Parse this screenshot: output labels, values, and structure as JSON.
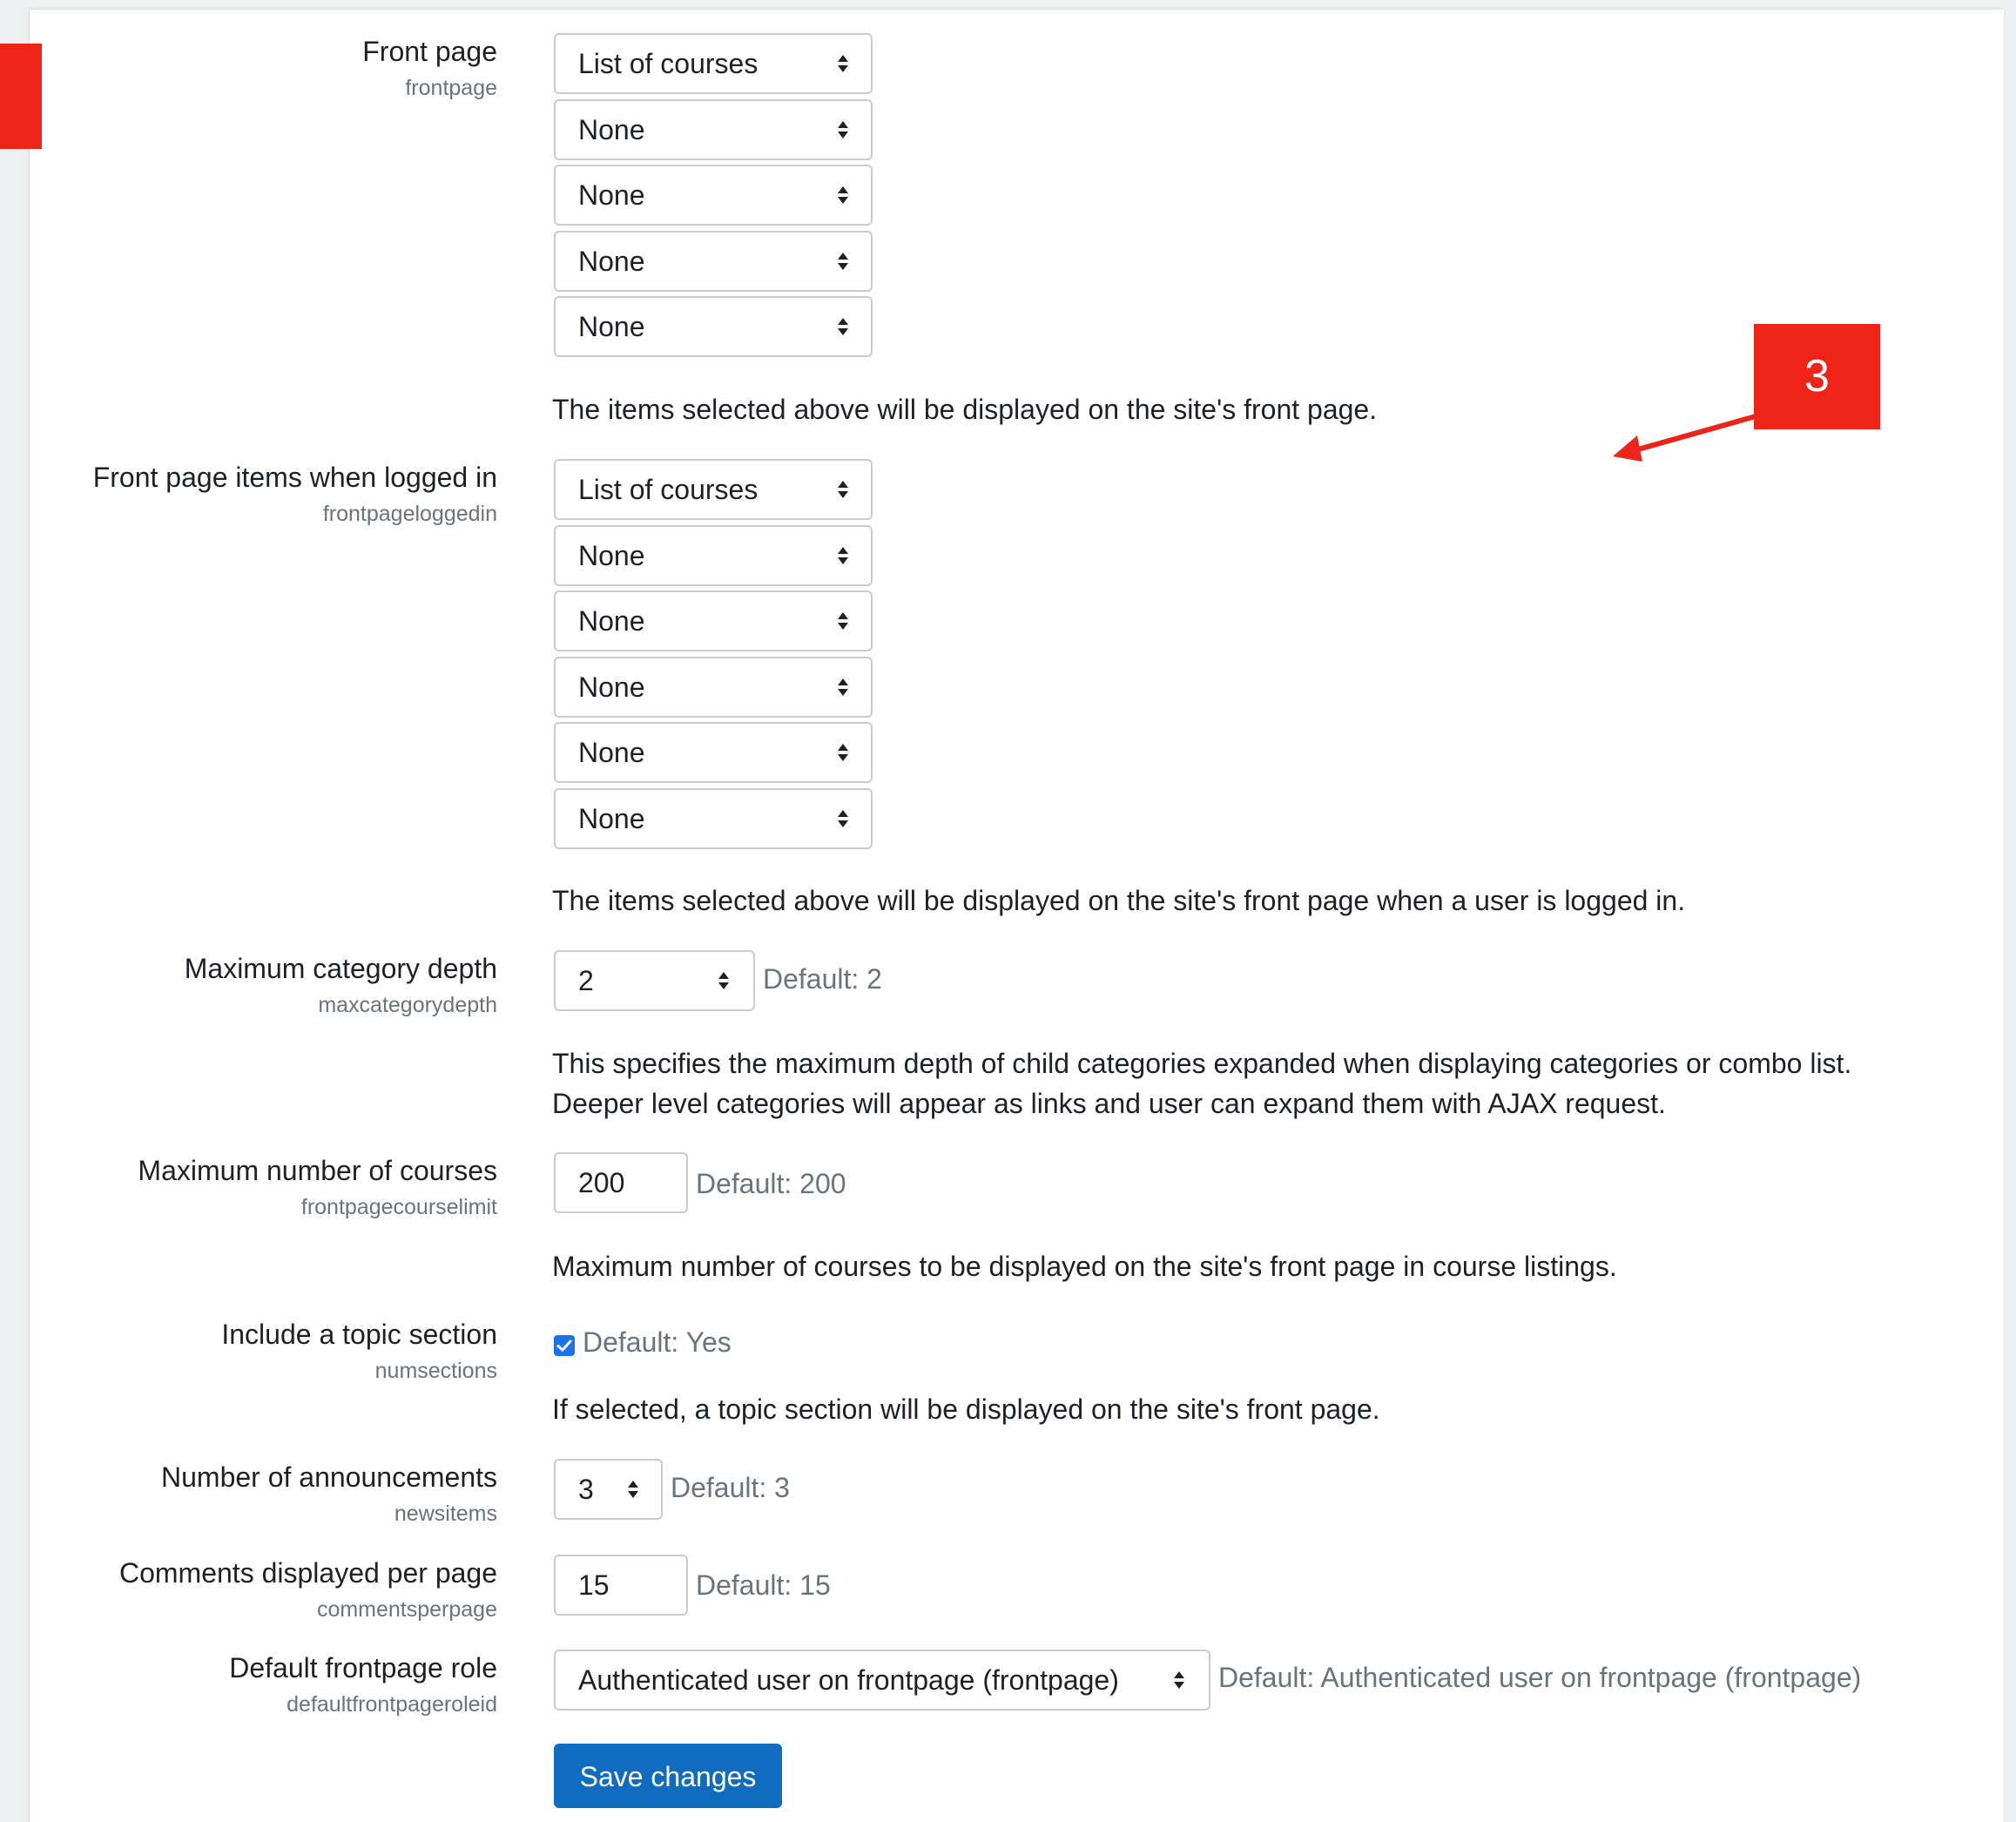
{
  "front_page": {
    "label": "Front page",
    "key": "frontpage",
    "selects": [
      "List of courses",
      "None",
      "None",
      "None",
      "None"
    ],
    "description": "The items selected above will be displayed on the site's front page."
  },
  "front_page_logged_in": {
    "label": "Front page items when logged in",
    "key": "frontpageloggedin",
    "selects": [
      "List of courses",
      "None",
      "None",
      "None",
      "None",
      "None"
    ],
    "description": "The items selected above will be displayed on the site's front page when a user is logged in."
  },
  "max_category_depth": {
    "label": "Maximum category depth",
    "key": "maxcategorydepth",
    "value": "2",
    "default": "Default: 2",
    "description_line1": "This specifies the maximum depth of child categories expanded when displaying categories or combo list.",
    "description_line2": "Deeper level categories will appear as links and user can expand them with AJAX request."
  },
  "max_courses": {
    "label": "Maximum number of courses",
    "key": "frontpagecourselimit",
    "value": "200",
    "default": "Default: 200",
    "description": "Maximum number of courses to be displayed on the site's front page in course listings."
  },
  "topic_section": {
    "label": "Include a topic section",
    "key": "numsections",
    "checked": true,
    "default": "Default: Yes",
    "description": "If selected, a topic section will be displayed on the site's front page."
  },
  "announcements": {
    "label": "Number of announcements",
    "key": "newsitems",
    "value": "3",
    "default": "Default: 3"
  },
  "comments_per_page": {
    "label": "Comments displayed per page",
    "key": "commentsperpage",
    "value": "15",
    "default": "Default: 15"
  },
  "frontpage_role": {
    "label": "Default frontpage role",
    "key": "defaultfrontpageroleid",
    "value": "Authenticated user on frontpage (frontpage)",
    "default": "Default: Authenticated user on frontpage (frontpage)"
  },
  "save_label": "Save changes",
  "annotation": {
    "number": "3",
    "color": "#ee2418"
  },
  "colors": {
    "primary_button": "#0f6cbf",
    "checkbox": "#1a73e8",
    "muted_text": "#6a737b"
  }
}
